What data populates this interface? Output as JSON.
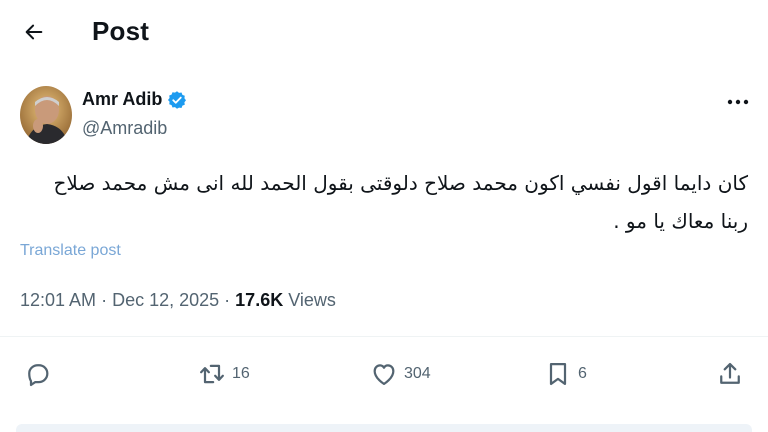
{
  "header": {
    "title": "Post",
    "back_icon": "arrow-left-icon"
  },
  "author": {
    "name": "Amr Adib",
    "handle": "@Amradib",
    "verified": true,
    "verified_color": "#1d9bf0"
  },
  "post": {
    "lines": [
      "كان دايما اقول نفسي اكون محمد صلاح دلوقتى بقول الحمد لله انى مش محمد صلاح",
      "ربنا معاك يا مو ."
    ],
    "translate_label": "Translate post"
  },
  "meta": {
    "time": "12:01 AM",
    "date": "Dec 12, 2025",
    "views_count": "17.6K",
    "views_label": "Views"
  },
  "actions": {
    "replies": "",
    "reposts": "16",
    "likes": "304",
    "bookmarks": "6"
  },
  "colors": {
    "text": "#0f1419",
    "muted": "#536471",
    "link": "#1d9bf0"
  }
}
